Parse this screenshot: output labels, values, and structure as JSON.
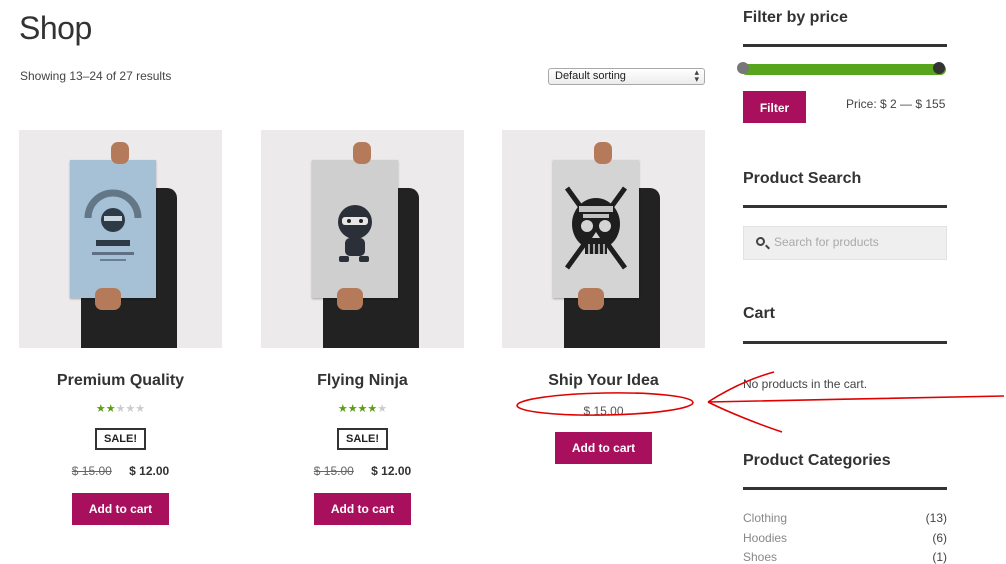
{
  "page": {
    "title": "Shop",
    "result_count": "Showing 13–24 of 27 results",
    "sorting": {
      "selected": "Default sorting"
    }
  },
  "products": [
    {
      "name": "Premium Quality",
      "rating_stars": 2,
      "sale_badge": "SALE!",
      "old_price": "$ 15.00",
      "price": "$ 12.00",
      "button": "Add to cart",
      "poster_color": "#a6c1d6"
    },
    {
      "name": "Flying Ninja",
      "rating_stars": 4,
      "sale_badge": "SALE!",
      "old_price": "$ 15.00",
      "price": "$ 12.00",
      "button": "Add to cart",
      "poster_color": "#cfcfcf"
    },
    {
      "name": "Ship Your Idea",
      "price": "$ 15.00",
      "button": "Add to cart",
      "poster_color": "#d4d4d4"
    }
  ],
  "sidebar": {
    "filter": {
      "title": "Filter by price",
      "button": "Filter",
      "range_label": "Price: $ 2 — $ 155",
      "slider_color": "#56a51d"
    },
    "search": {
      "title": "Product Search",
      "placeholder": "Search for products"
    },
    "cart": {
      "title": "Cart",
      "empty_message": "No products in the cart."
    },
    "categories": {
      "title": "Product Categories",
      "items": [
        {
          "name": "Clothing",
          "count": "(13)"
        },
        {
          "name": "Hoodies",
          "count": "(6)"
        },
        {
          "name": "Shoes",
          "count": "(1)"
        }
      ]
    }
  },
  "colors": {
    "accent": "#a8105e",
    "rating": "#5c9d15",
    "annotation": "#e00000"
  }
}
